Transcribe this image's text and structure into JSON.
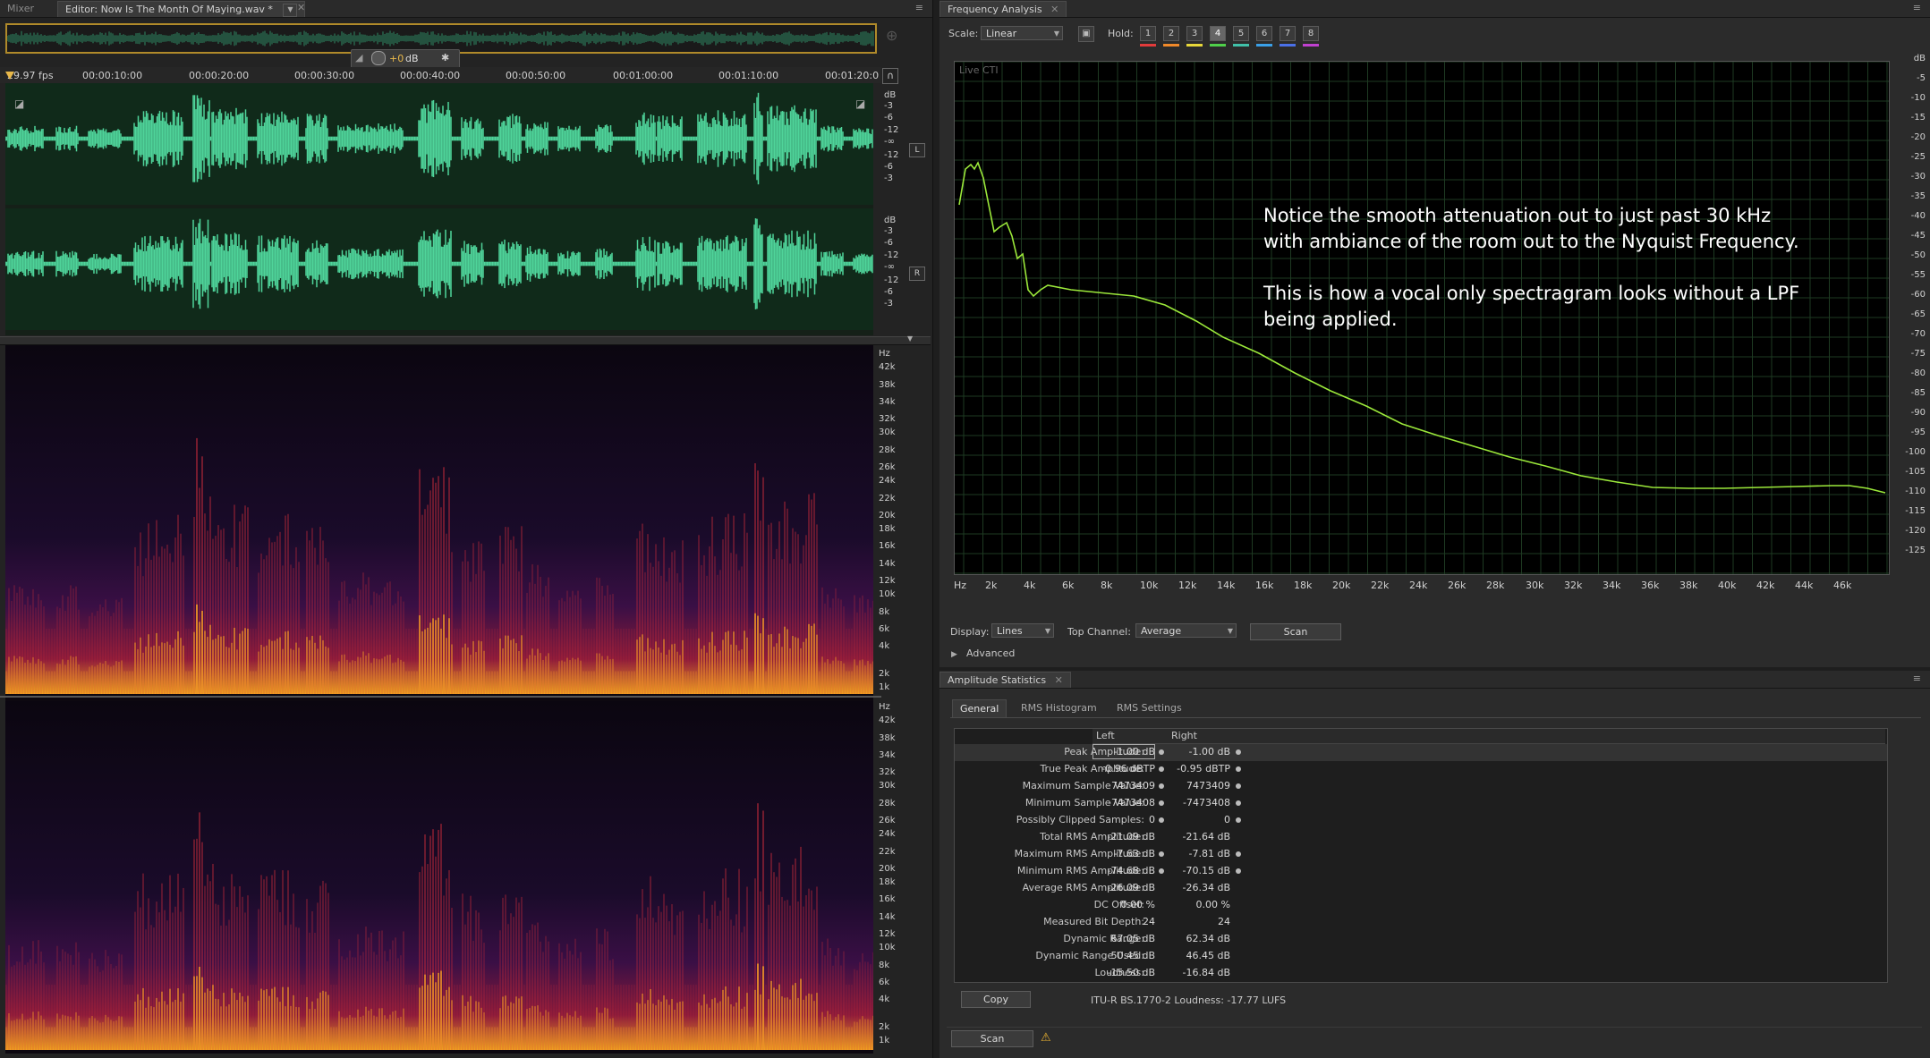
{
  "tabs": {
    "mixer": "Mixer",
    "editor": "Editor: Now Is The Month Of Maying.wav *"
  },
  "hud": {
    "gain": "+0",
    "unit": "dB"
  },
  "timeline": {
    "fps": "29.97 fps",
    "ticks": [
      "00:00:10:00",
      "00:00:20:00",
      "00:00:30:00",
      "00:00:40:00",
      "00:00:50:00",
      "00:01:00:00",
      "00:01:10:00",
      "00:01:20:0"
    ]
  },
  "waveform": {
    "db_labels_top": [
      "dB",
      "-3",
      "-6",
      "-12",
      "-∞",
      "-12",
      "-6",
      "-3"
    ],
    "channel_L": "L",
    "channel_R": "R",
    "color": "#4fd49a"
  },
  "spectral": {
    "hz_labels": [
      "Hz",
      "42k",
      "38k",
      "34k",
      "32k",
      "30k",
      "28k",
      "26k",
      "24k",
      "22k",
      "20k",
      "18k",
      "16k",
      "14k",
      "12k",
      "10k",
      "8k",
      "6k",
      "4k",
      "2k",
      "1k"
    ]
  },
  "frequency": {
    "title": "Frequency Analysis",
    "scale_label": "Scale:",
    "scale_value": "Linear",
    "hold_label": "Hold:",
    "hold_buttons": [
      "1",
      "2",
      "3",
      "4",
      "5",
      "6",
      "7",
      "8"
    ],
    "hold_active": "4",
    "hold_colors": [
      "#e23b3b",
      "#f0892a",
      "#e8d83a",
      "#4fd04a",
      "#40c0a8",
      "#3aa0e8",
      "#4a70e8",
      "#c040d0"
    ],
    "live_cti": "Live CTI",
    "y_labels": [
      "dB",
      "-5",
      "-10",
      "-15",
      "-20",
      "-25",
      "-30",
      "-35",
      "-40",
      "-45",
      "-50",
      "-55",
      "-60",
      "-65",
      "-70",
      "-75",
      "-80",
      "-85",
      "-90",
      "-95",
      "-100",
      "-105",
      "-110",
      "-115",
      "-120",
      "-125"
    ],
    "x_labels": [
      "Hz",
      "2k",
      "4k",
      "6k",
      "8k",
      "10k",
      "12k",
      "14k",
      "16k",
      "18k",
      "20k",
      "22k",
      "24k",
      "26k",
      "28k",
      "30k",
      "32k",
      "34k",
      "36k",
      "38k",
      "40k",
      "42k",
      "44k",
      "46k"
    ],
    "note_lines": [
      "Notice the smooth attenuation out to just past 30 kHz",
      "with ambiance of the room out to the Nyquist Frequency.",
      "",
      "This is how a vocal only spectragram looks without a LPF",
      "being applied."
    ],
    "display_label": "Display:",
    "display_value": "Lines",
    "top_channel_label": "Top Channel:",
    "top_channel_value": "Average",
    "scan_label": "Scan",
    "advanced_label": "Advanced",
    "curve_color": "#9be83a"
  },
  "amplitude": {
    "title": "Amplitude Statistics",
    "subtabs": [
      "General",
      "RMS Histogram",
      "RMS Settings"
    ],
    "col_left": "Left",
    "col_right": "Right",
    "rows": [
      {
        "label": "Peak Amplitude:",
        "left": "-1.00 dB",
        "right": "-1.00 dB",
        "dot": true
      },
      {
        "label": "True Peak Amplitude:",
        "left": "-0.96 dBTP",
        "right": "-0.95 dBTP",
        "dot": true
      },
      {
        "label": "Maximum Sample Value:",
        "left": "7473409",
        "right": "7473409",
        "dot": true
      },
      {
        "label": "Minimum Sample Value:",
        "left": "-7473408",
        "right": "-7473408",
        "dot": true
      },
      {
        "label": "Possibly Clipped Samples:",
        "left": "0",
        "right": "0",
        "dot": true
      },
      {
        "label": "Total RMS Amplitude:",
        "left": "-21.09 dB",
        "right": "-21.64 dB",
        "dot": false
      },
      {
        "label": "Maximum RMS Amplitude:",
        "left": "-7.63 dB",
        "right": "-7.81 dB",
        "dot": true
      },
      {
        "label": "Minimum RMS Amplitude:",
        "left": "-74.68 dB",
        "right": "-70.15 dB",
        "dot": true
      },
      {
        "label": "Average RMS Amplitude:",
        "left": "-26.09 dB",
        "right": "-26.34 dB",
        "dot": false
      },
      {
        "label": "DC Offset:",
        "left": "0.00 %",
        "right": "0.00 %",
        "dot": false
      },
      {
        "label": "Measured Bit Depth:",
        "left": "24",
        "right": "24",
        "dot": false
      },
      {
        "label": "Dynamic Range:",
        "left": "67.05 dB",
        "right": "62.34 dB",
        "dot": false
      },
      {
        "label": "Dynamic Range Used:",
        "left": "50.45 dB",
        "right": "46.45 dB",
        "dot": false
      },
      {
        "label": "Loudness:",
        "left": "-15.50 dB",
        "right": "-16.84 dB",
        "dot": false
      }
    ],
    "copy_label": "Copy",
    "loudness_text": "ITU-R BS.1770-2 Loudness: -17.77 LUFS",
    "scan_label": "Scan"
  }
}
